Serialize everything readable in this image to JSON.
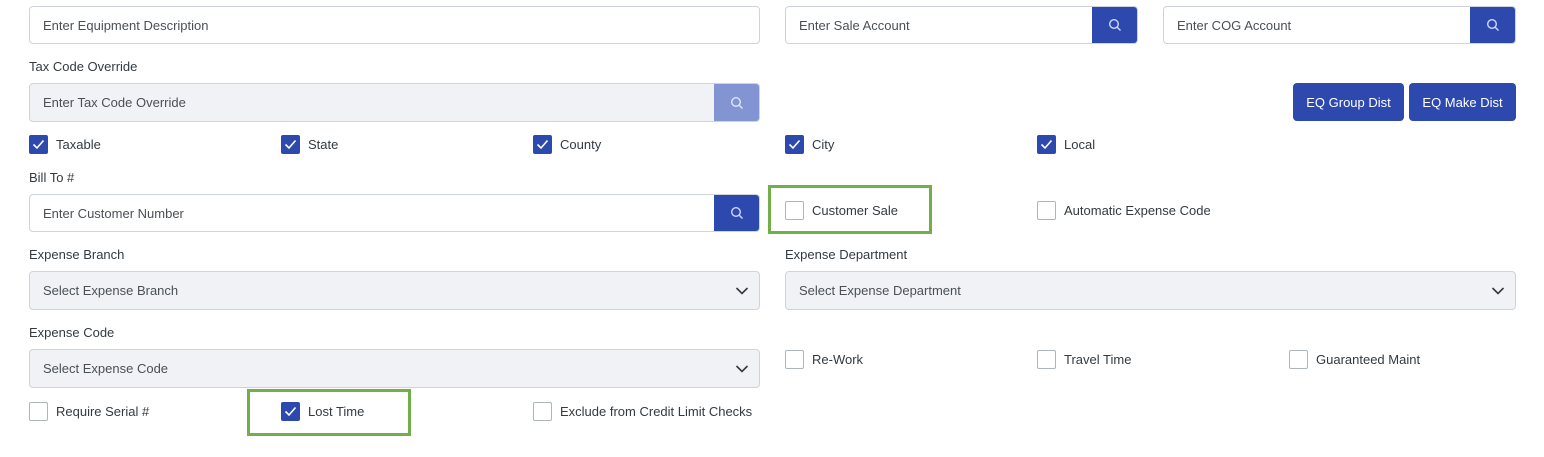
{
  "equipment_description": {
    "placeholder": "Enter Equipment Description"
  },
  "sale_account": {
    "placeholder": "Enter Sale Account"
  },
  "cog_account": {
    "placeholder": "Enter COG Account"
  },
  "tax_code_override": {
    "label": "Tax Code Override",
    "placeholder": "Enter Tax Code Override"
  },
  "buttons": {
    "eq_group_dist": "EQ Group Dist",
    "eq_make_dist": "EQ Make Dist"
  },
  "tax_checkboxes": [
    {
      "label": "Taxable",
      "checked": true
    },
    {
      "label": "State",
      "checked": true
    },
    {
      "label": "County",
      "checked": true
    },
    {
      "label": "City",
      "checked": true
    },
    {
      "label": "Local",
      "checked": true
    }
  ],
  "bill_to": {
    "label": "Bill To #",
    "placeholder": "Enter Customer Number"
  },
  "customer_sale": {
    "label": "Customer Sale",
    "checked": false
  },
  "automatic_expense_code": {
    "label": "Automatic Expense Code",
    "checked": false
  },
  "expense_branch": {
    "label": "Expense Branch",
    "value": "Select Expense Branch"
  },
  "expense_department": {
    "label": "Expense Department",
    "value": "Select Expense Department"
  },
  "expense_code": {
    "label": "Expense Code",
    "value": "Select Expense Code"
  },
  "rework": {
    "label": "Re-Work",
    "checked": false
  },
  "travel_time": {
    "label": "Travel Time",
    "checked": false
  },
  "guaranteed_maint": {
    "label": "Guaranteed Maint",
    "checked": false
  },
  "require_serial": {
    "label": "Require Serial #",
    "checked": false
  },
  "lost_time": {
    "label": "Lost Time",
    "checked": true
  },
  "exclude_credit": {
    "label": "Exclude from Credit Limit Checks",
    "checked": false
  },
  "colors": {
    "primary": "#2d49ad",
    "primary_disabled": "#8394d3",
    "highlight": "#72af48"
  }
}
